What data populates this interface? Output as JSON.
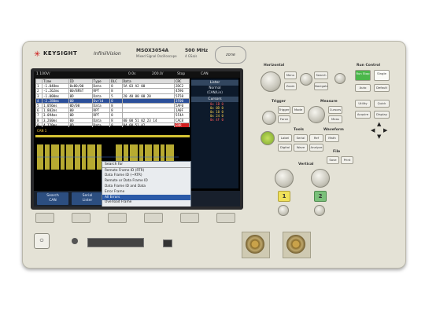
{
  "brand": {
    "logo_icon": "keysight-logo-icon",
    "name": "KEYSIGHT",
    "series": "InfiniiVision",
    "model": "MSOX3054A",
    "model_sub": "Mixed Signal Oscilloscope",
    "bandwidth": "500 MHz",
    "sample_rate": "4 GSa/s",
    "zone_badge": "zone"
  },
  "status": {
    "channel": "1 100V/",
    "timebase": "0.0s",
    "scale": "200.0/",
    "mode": "Stop",
    "trig": "CAN"
  },
  "lister": {
    "columns": [
      "",
      "Time",
      "ID",
      "Type",
      "DLC",
      "Data",
      "CRC"
    ],
    "rows": [
      [
        "1",
        "-1.048ms",
        "0x80/00",
        "Data",
        "8",
        "5A 03 A2 00",
        "2DC2"
      ],
      [
        "2",
        "-1.262ms",
        "00/BRST",
        "RPT",
        "8",
        "",
        "4596"
      ],
      [
        "3",
        "-1.000ms",
        "0D",
        "Data",
        "5",
        "20 40 00 00 20",
        "5F58"
      ],
      [
        "4",
        "-2.280ms",
        "00",
        "Ovrld",
        "0",
        "",
        "3F00"
      ],
      [
        "5",
        "1.056ms",
        "0D/00",
        "Data",
        "8",
        "",
        "5AF0"
      ],
      [
        "6",
        "1.802ms",
        "00",
        "RPT",
        "8",
        "",
        "1A0F"
      ],
      [
        "7",
        "3.094ms",
        "0D",
        "RPT",
        "8",
        "",
        "5F4A"
      ],
      [
        "8",
        "3.260ms",
        "00",
        "Data",
        "8",
        "00 00 51 02 23 14",
        "CAC8"
      ],
      [
        "9",
        "4.120ms",
        "0D",
        "Data",
        "8",
        "94 00 51 A2",
        "ERR"
      ]
    ]
  },
  "sidepanel": {
    "title1": "Lister",
    "l1": "Normal",
    "l2": "(CAN/Lin)",
    "title2": "Cursors",
    "decode": [
      "0x 1B 0",
      "0x 0D 0",
      "0x 10 0",
      "0x 24 0",
      "0x 4F 0"
    ]
  },
  "wave": {
    "label": "CAN 1"
  },
  "menu": {
    "title": "Search for",
    "items": [
      "Remote Frame ID (RTR)",
      "Data Frame ID (~RTR)",
      "Remote or Data Frame ID",
      "Data Frame ID and Data",
      "Error Frame",
      "All Errors",
      "Overload Frame"
    ],
    "active_index": 5
  },
  "softlabels": [
    "Search\nCAN",
    "Serial\nLister",
    "Search for\nAll Errors",
    "Ok\n▼",
    "",
    ""
  ],
  "rpanel": {
    "horizontal": "Horizontal",
    "run_control": "Run Control",
    "run_stop": "Run Stop",
    "single": "Single",
    "trigger": "Trigger",
    "measure": "Measure",
    "tools": "Tools",
    "waveform": "Waveform",
    "file": "File",
    "vertical": "Vertical",
    "btn_labels": {
      "menu": "Menu",
      "zoom": "Zoom",
      "search": "Search",
      "navigate": "Navigate",
      "auto": "Auto Scale",
      "default": "Default Setup",
      "cursors": "Cursors",
      "meas": "Meas",
      "trig": "Trigger",
      "force": "Force",
      "mode": "Mode",
      "label": "Label",
      "ref": "Ref",
      "math": "Math",
      "save": "Save",
      "print": "Print",
      "utility": "Utility",
      "quick": "Quick Action",
      "acquire": "Acquire",
      "display": "Display",
      "serial": "Serial",
      "digital": "Digital",
      "wavegen": "Wave Gen",
      "analyze": "Analyze"
    }
  },
  "front": {
    "power_icon": "power-icon",
    "ch1": "1",
    "ch2": "2"
  }
}
